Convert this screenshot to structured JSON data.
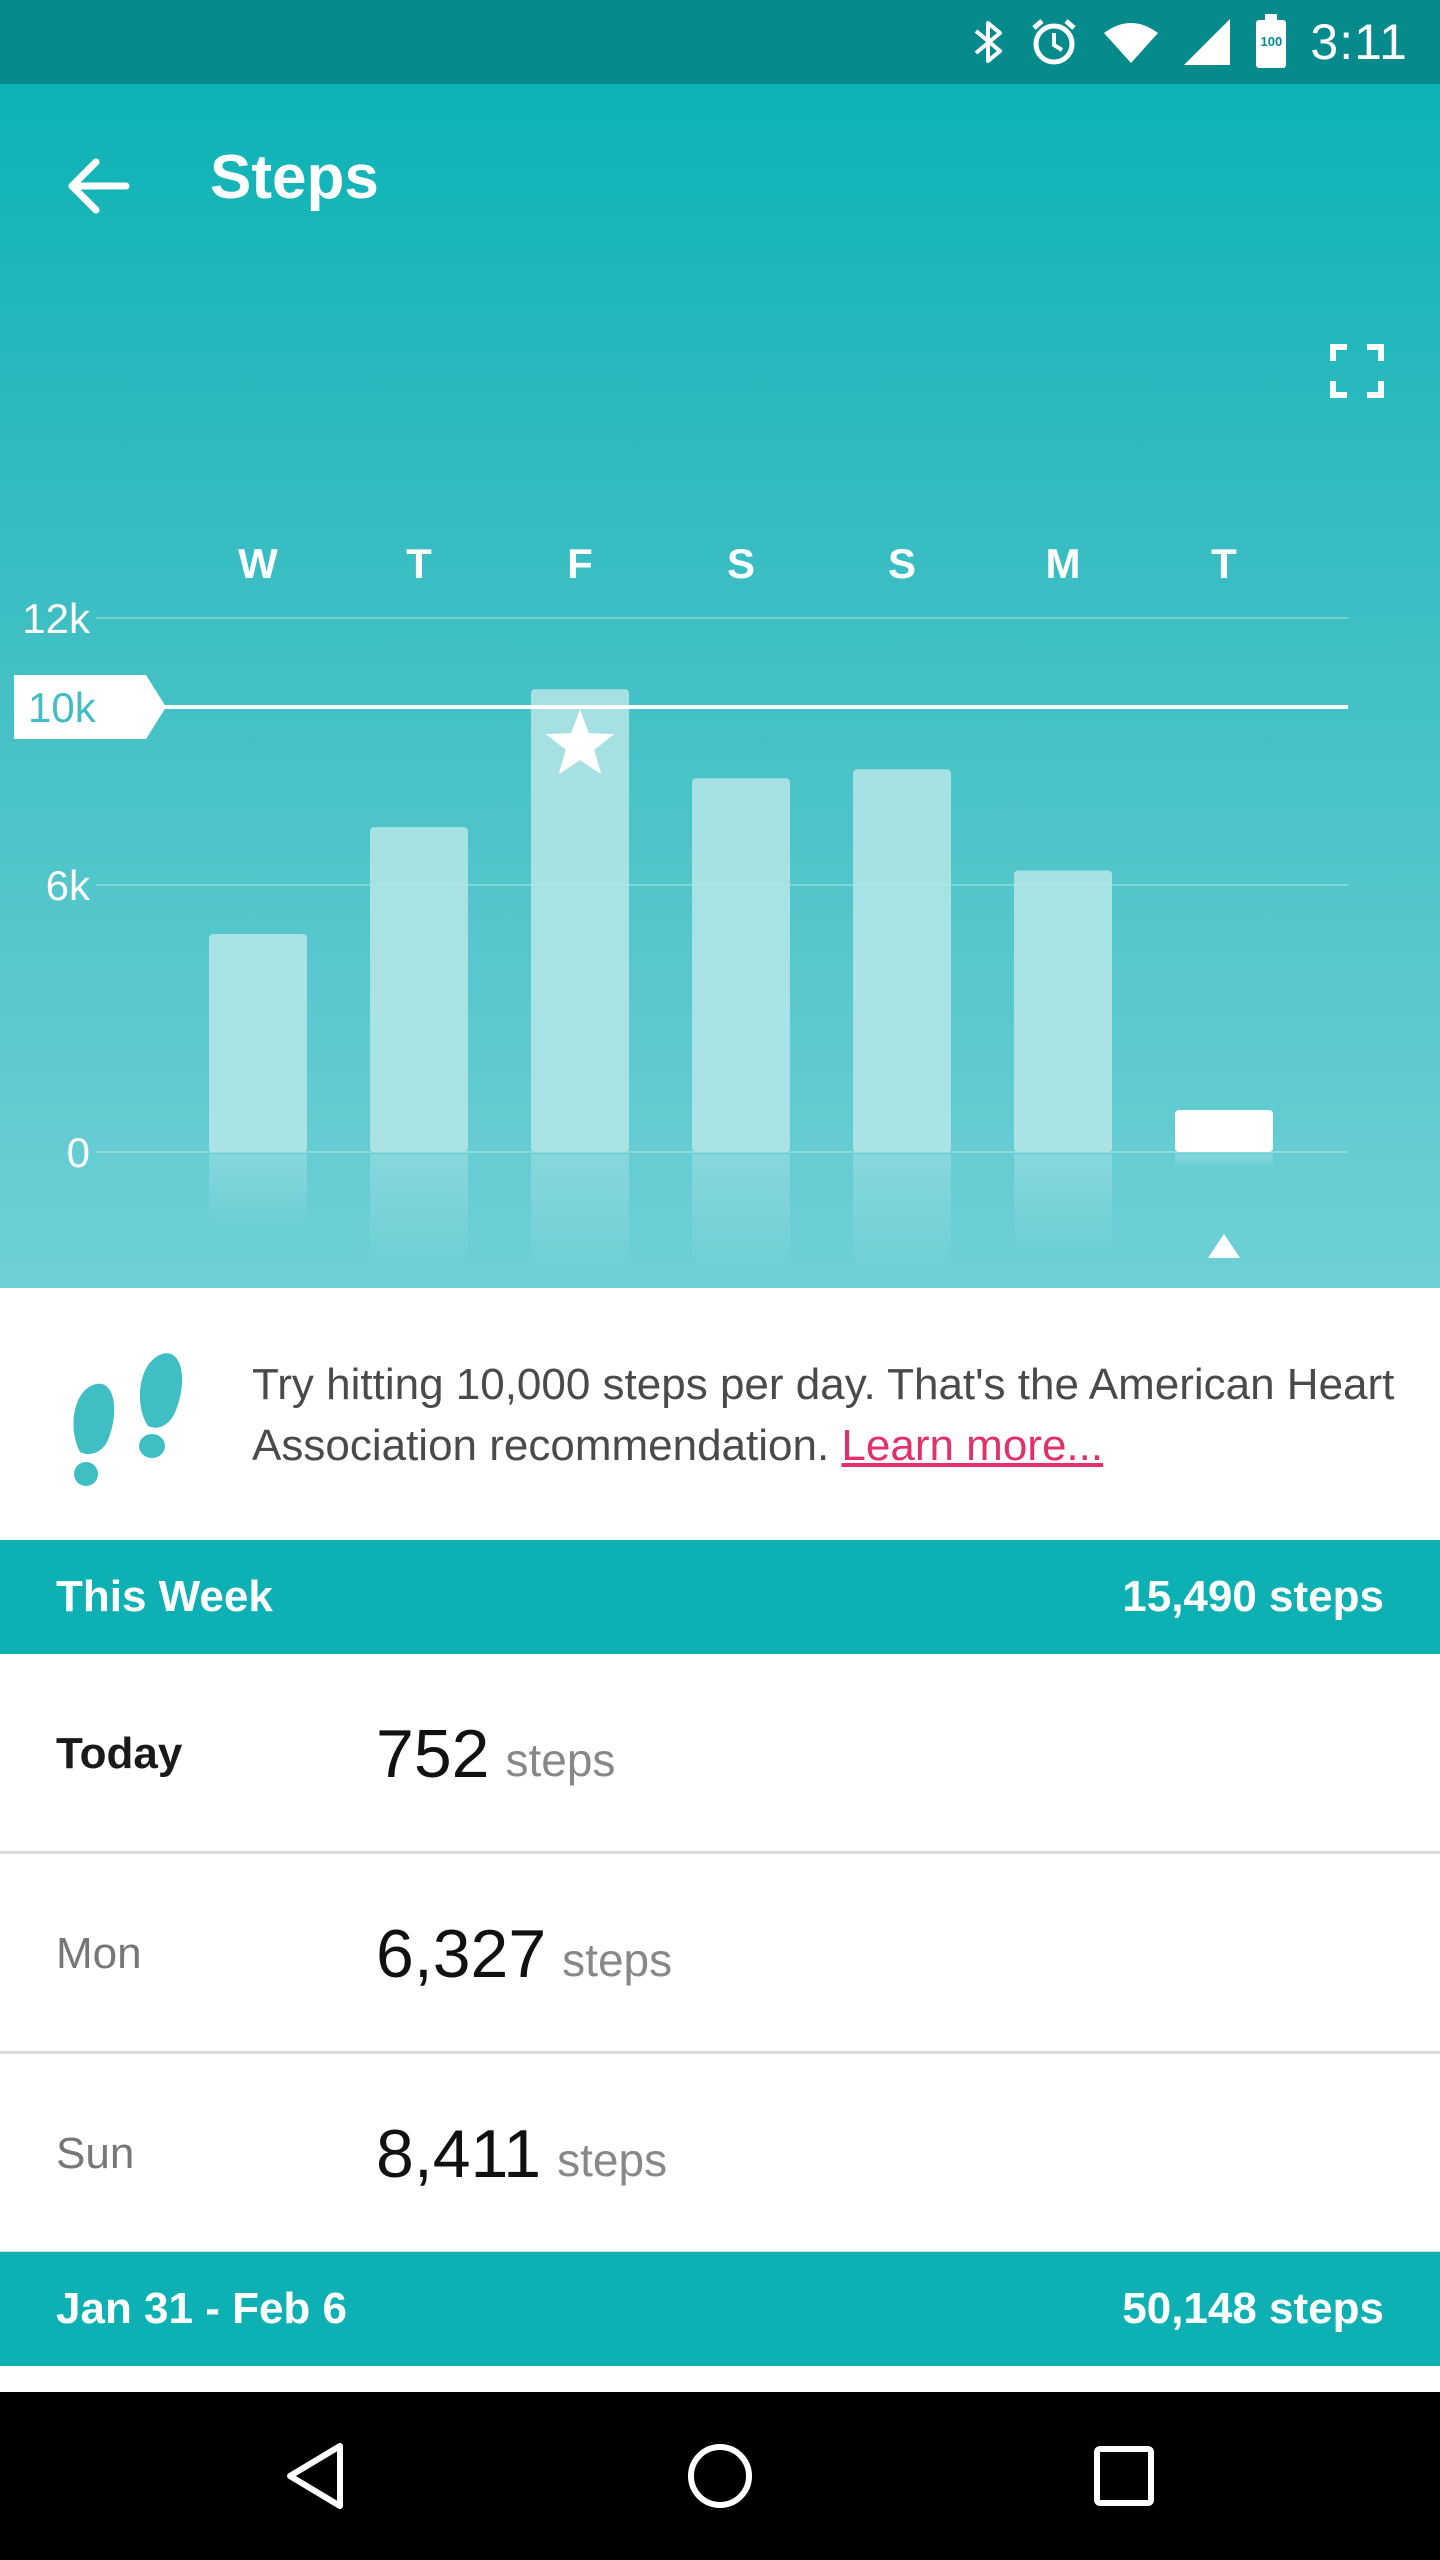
{
  "status_bar": {
    "time": "3:11",
    "battery_level": "100",
    "icons": [
      "bluetooth-icon",
      "alarm-icon",
      "wifi-icon",
      "cell-signal-icon",
      "battery-icon"
    ]
  },
  "app_bar": {
    "title": "Steps",
    "back_icon": "arrow-left-icon",
    "expand_icon": "fullscreen-icon"
  },
  "chart_data": {
    "type": "bar",
    "categories": [
      "W",
      "T",
      "F",
      "S",
      "S",
      "M",
      "T"
    ],
    "values": [
      4900,
      7300,
      10400,
      8400,
      8600,
      6327,
      752
    ],
    "y_ticks": [
      "12k",
      "6k",
      "0"
    ],
    "y_tick_values": [
      12000,
      6000,
      0
    ],
    "goal_value": 10000,
    "goal_label": "10k",
    "ylim": [
      0,
      12000
    ],
    "star_on_index": 2,
    "current_index": 6,
    "current_label": "Today",
    "colors": {
      "bar": "#b6e6e7",
      "bar_current": "#ffffff",
      "goal_line": "#ffffff"
    }
  },
  "tip": {
    "icon": "footprints-icon",
    "text": "Try hitting 10,000 steps per day. That's the American Heart Association recommendation. ",
    "link_text": "Learn more..."
  },
  "this_week": {
    "label": "This Week",
    "total": "15,490 steps",
    "days": [
      {
        "day": "Today",
        "count": "752",
        "unit": "steps"
      },
      {
        "day": "Mon",
        "count": "6,327",
        "unit": "steps"
      },
      {
        "day": "Sun",
        "count": "8,411",
        "unit": "steps"
      }
    ]
  },
  "previous_week": {
    "label": "Jan 31 - Feb 6",
    "total": "50,148 steps"
  },
  "nav_bar": {
    "icons": [
      "back-triangle-icon",
      "home-circle-icon",
      "recents-square-icon"
    ]
  },
  "colors": {
    "status_bar": "#078a8c",
    "header_teal": "#0db0b3",
    "link_pink": "#e1306c",
    "footprint_teal": "#3fbfc3"
  }
}
